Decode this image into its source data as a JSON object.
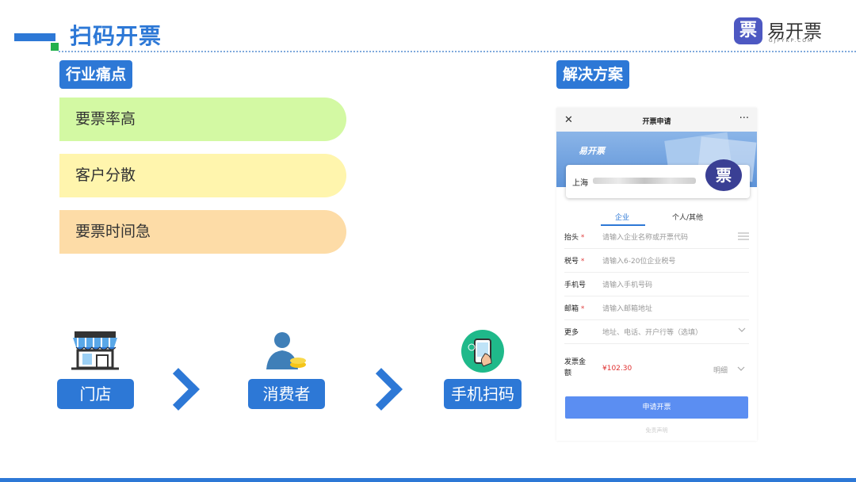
{
  "header": {
    "title": "扫码开票"
  },
  "logo": {
    "mark": "票",
    "name": "易开票",
    "domain": "GJPYKP.COM"
  },
  "pain": {
    "tag": "行业痛点",
    "items": [
      {
        "label": "要票率高",
        "color": "#d3f9a3"
      },
      {
        "label": "客户分散",
        "color": "#fff5ad"
      },
      {
        "label": "要票时间急",
        "color": "#fddca7"
      }
    ]
  },
  "flow": {
    "steps": [
      "门店",
      "消费者",
      "手机扫码"
    ]
  },
  "solution": {
    "tag": "解决方案",
    "phone": {
      "close_glyph": "✕",
      "title": "开票申请",
      "more_glyph": "···",
      "banner_text": "易开票",
      "company": "上海",
      "stamp": "票",
      "tabs": [
        "企业",
        "个人/其他"
      ],
      "fields": [
        {
          "label": "抬头",
          "required": "*",
          "placeholder": "请输入企业名称或开票代码"
        },
        {
          "label": "税号",
          "required": "*",
          "placeholder": "请输入6-20位企业税号"
        },
        {
          "label": "手机号",
          "required": "",
          "placeholder": "请输入手机号码"
        },
        {
          "label": "邮箱",
          "required": "*",
          "placeholder": "请输入邮箱地址"
        },
        {
          "label": "更多",
          "required": "",
          "placeholder": "地址、电话、开户行等（选填）"
        }
      ],
      "amount_label": "发票金额",
      "amount_value": "¥102.30",
      "detail": "明细",
      "submit": "申请开票",
      "footer": "免责声明"
    }
  }
}
